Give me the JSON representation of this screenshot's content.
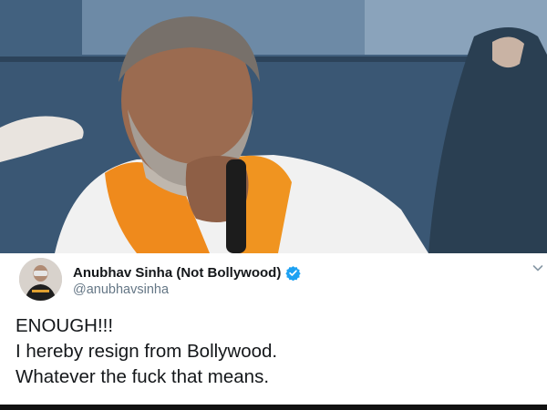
{
  "photo": {
    "icon": "person-speaking-into-microphone",
    "colors": {
      "backdrop": "#3f5e7c",
      "scarf": "#f08a1c",
      "kurta": "#f2f2f2",
      "skin": "#9a6a50"
    }
  },
  "tweet": {
    "author": {
      "display_name": "Anubhav Sinha (Not Bollywood)",
      "handle": "@anubhavsinha",
      "verified": true,
      "verified_color": "#1da1f2"
    },
    "menu_icon": "chevron-down-icon",
    "lines": [
      "ENOUGH!!!",
      "I hereby resign from Bollywood.",
      "Whatever the fuck that means."
    ]
  }
}
